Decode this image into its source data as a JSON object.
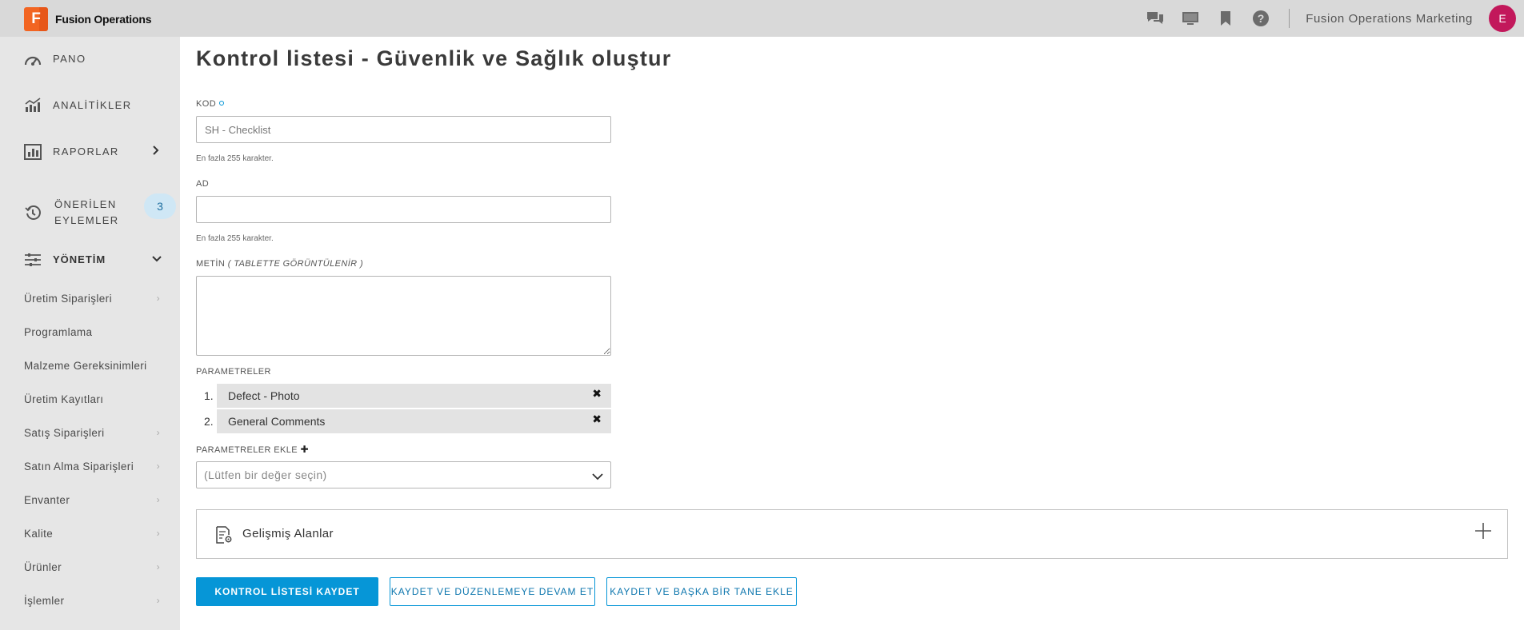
{
  "app": {
    "logo_letter": "F",
    "name": "Fusion Operations",
    "org_name": "Fusion Operations Marketing",
    "user_initial": "E",
    "accent": "#0696d7",
    "brand_color": "#f26522",
    "avatar_color": "#c2185b"
  },
  "topbar_icons": [
    "chat-icon",
    "monitor-icon",
    "bookmark-icon",
    "help-icon"
  ],
  "sidebar": {
    "main": [
      {
        "label": "PANO",
        "icon": "dashboard-icon"
      },
      {
        "label": "ANALİTİKLER",
        "icon": "analytics-icon"
      },
      {
        "label": "RAPORLAR",
        "icon": "reports-icon"
      },
      {
        "label_line1": "ÖNERİLEN",
        "label_line2": "EYLEMLER",
        "icon": "history-icon",
        "badge": "3"
      },
      {
        "label": "YÖNETİM",
        "icon": "sliders-icon"
      }
    ],
    "sub": [
      "Üretim Siparişleri",
      "Programlama",
      "Malzeme Gereksinimleri",
      "Üretim Kayıtları",
      "Satış Siparişleri",
      "Satın Alma Siparişleri",
      "Envanter",
      "Kalite",
      "Ürünler",
      "İşlemler"
    ]
  },
  "form": {
    "title": "Kontrol listesi - Güvenlik ve Sağlık oluştur",
    "kod_label": "KOD",
    "kod_placeholder": "SH - Checklist",
    "kod_helper": "En fazla 255 karakter.",
    "ad_label": "AD",
    "ad_value": "",
    "ad_helper": "En fazla 255 karakter.",
    "metin_label": "METİN",
    "metin_note": "( TABLETTE GÖRÜNTÜLENİR )",
    "parametreler_label": "PARAMETRELER",
    "parameters": [
      {
        "num": "1.",
        "name": "Defect - Photo",
        "remove": "✖"
      },
      {
        "num": "2.",
        "name": "General Comments",
        "remove": "✖"
      }
    ],
    "add_param_label": "PARAMETRELER EKLE",
    "add_param_plus": "✚",
    "select_placeholder": "(Lütfen bir değer seçin)",
    "advanced_label": "Gelişmiş Alanlar",
    "buttons": {
      "save": "KONTROL LİSTESİ KAYDET",
      "save_continue": "KAYDET VE DÜZENLEMEYE DEVAM ET",
      "save_add": "KAYDET VE BAŞKA BİR TANE EKLE"
    }
  }
}
